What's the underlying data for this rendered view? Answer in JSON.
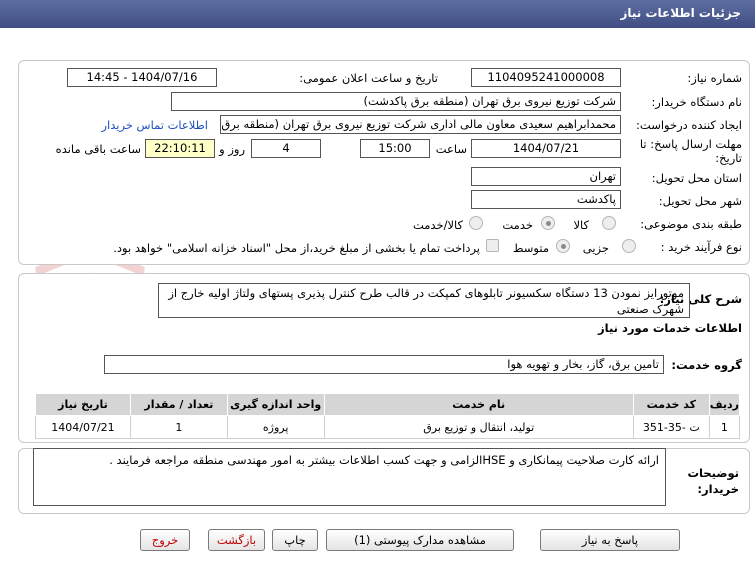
{
  "header": {
    "title": "جزئیات اطلاعات نیاز"
  },
  "form": {
    "need_number_label": "شماره نیاز:",
    "need_number": "1104095241000008",
    "announce_label": "تاریخ و ساعت اعلان عمومی:",
    "announce_value": "1404/07/16 - 14:45",
    "buyer_label": "نام دستگاه خریدار:",
    "buyer_value": "شرکت توزیع نیروی برق تهران (منطقه برق پاکدشت)",
    "creator_label": "ایجاد کننده درخواست:",
    "creator_value": "محمدابراهیم سعیدی معاون مالی اداری  شرکت توزیع نیروی برق تهران (منطقه برق",
    "contact_link": "اطلاعات تماس خریدار",
    "deadline_label": "مهلت ارسال پاسخ: تا",
    "deadline_label2": "تاریخ:",
    "deadline_date": "1404/07/21",
    "time_label": "ساعت",
    "deadline_time": "15:00",
    "days_value": "4",
    "days_label": "روز و",
    "remaining_time": "22:10:11",
    "remaining_label": "ساعت باقی مانده",
    "province_label": "استان محل تحویل:",
    "province_value": "تهران",
    "city_label": "شهر محل تحویل:",
    "city_value": "پاکدشت",
    "category_label": "طبقه بندی موضوعی:",
    "category_options": [
      "کالا",
      "خدمت",
      "کالا/خدمت"
    ],
    "category_selected": "خدمت",
    "process_label": "نوع فرآیند خرید :",
    "process_options": [
      "جزیی",
      "متوسط"
    ],
    "process_selected": "متوسط",
    "payment_text": "پرداخت تمام یا بخشی از مبلغ خرید،از محل \"اسناد خزانه اسلامی\" خواهد بود."
  },
  "summary": {
    "label": "شرح کلی نیاز:",
    "text": "موتورایز نمودن 13 دستگاه سکسیونر تابلوهای کمپکت در قالب طرح کنترل پذیری پستهای ولتاژ اولیه خارج از شهرک صنعتی"
  },
  "services": {
    "title": "اطلاعات خدمات مورد نیاز",
    "group_label": "گروه خدمت:",
    "group_value": "تامین برق، گاز، بخار و تهویه هوا",
    "columns": [
      "ردیف",
      "کد خدمت",
      "نام خدمت",
      "واحد اندازه گیری",
      "تعداد / مقدار",
      "تاریخ نیاز"
    ],
    "rows": [
      [
        "1",
        "ت -35-351",
        "تولید، انتقال و توزیع برق",
        "پروژه",
        "1",
        "1404/07/21"
      ]
    ]
  },
  "notes": {
    "label": "توضیحات",
    "label2": "خریدار:",
    "text": "ارائه کارت صلاحیت پیمانکاری و HSEالزامی و جهت کسب اطلاعات بیشتر به امور مهندسی منطقه مراجعه فرمایند ."
  },
  "buttons": {
    "reply": "پاسخ به نیاز",
    "attachments": "مشاهده مدارک پیوستی (1)",
    "print": "چاپ",
    "back": "بازگشت",
    "exit": "خروج"
  },
  "watermark": {
    "brand": "AriaTender.net"
  },
  "colors": {
    "title_bar": "#4a5a90",
    "link": "#1f4fbf",
    "remaining_bg": "#ffffc8",
    "exit_text": "#c00000"
  }
}
